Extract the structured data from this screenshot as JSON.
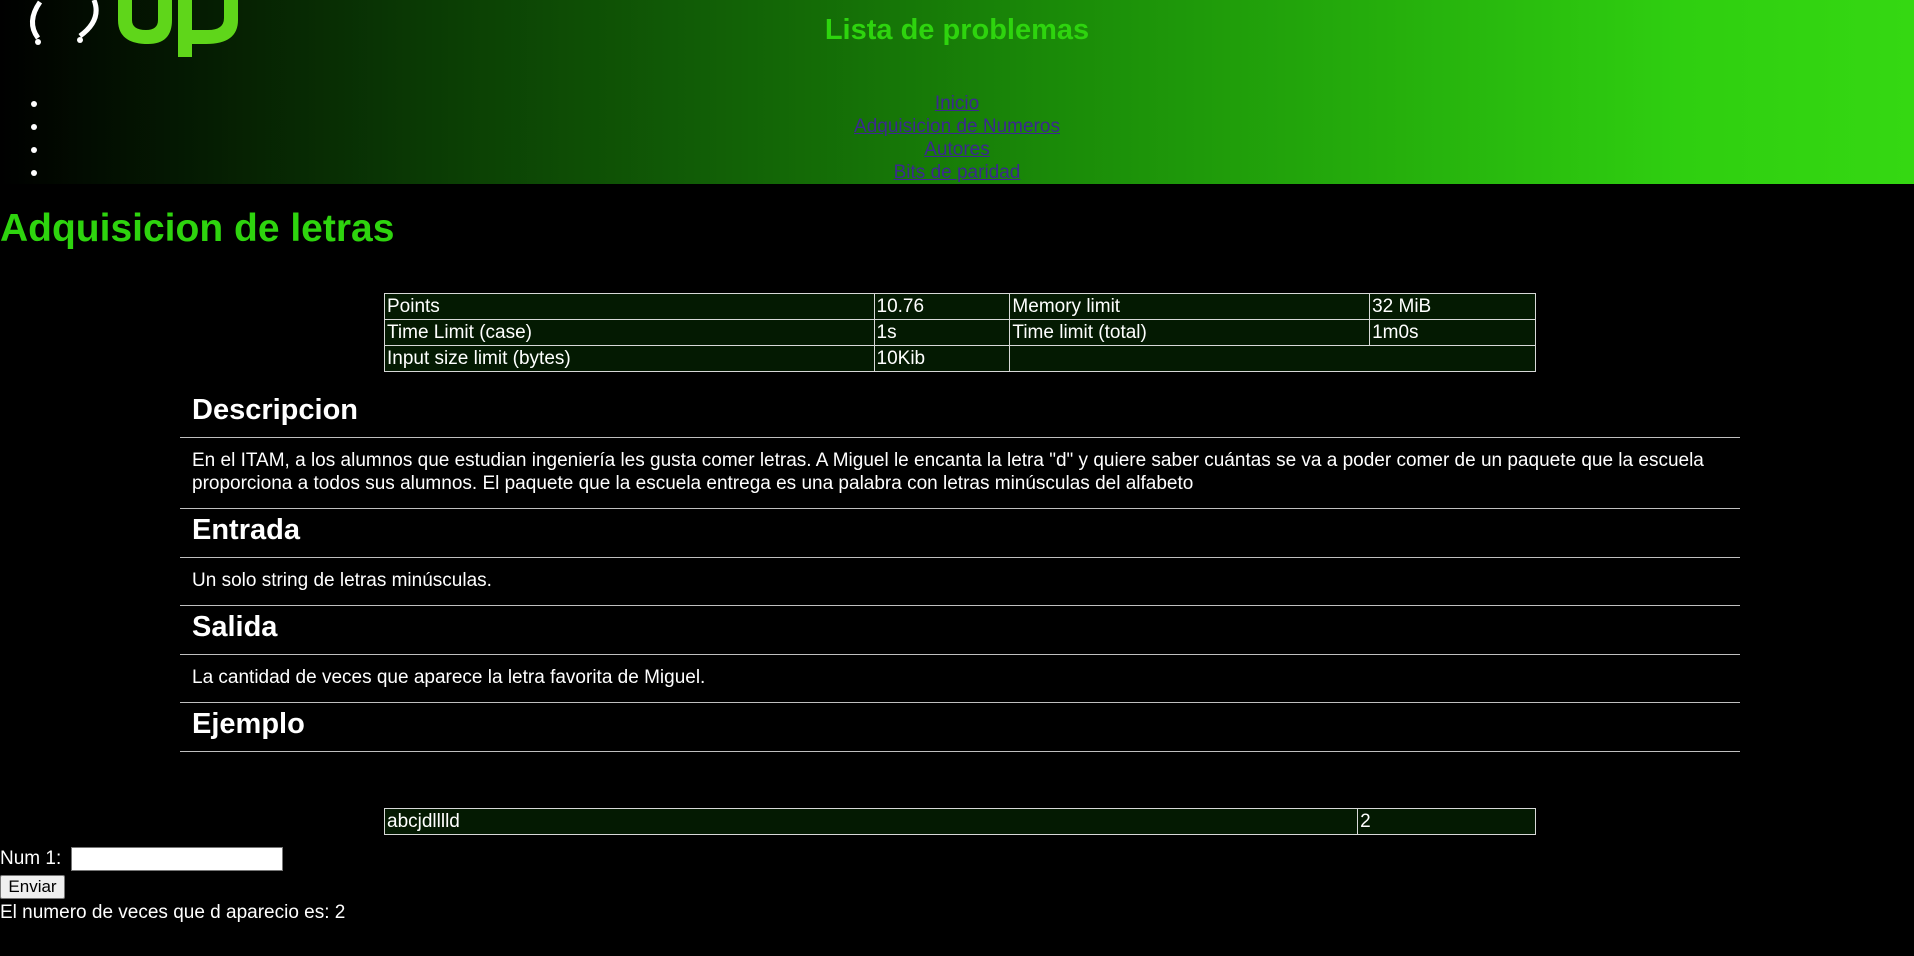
{
  "header": {
    "site_title": "Lista de problemas",
    "logo_text": "Up",
    "nav_items": [
      "Inicio",
      "Adquisicion de Numeros",
      "Autores",
      "Bits de paridad"
    ]
  },
  "problem": {
    "title": "Adquisicion de letras",
    "info": [
      [
        "Points",
        "10.76",
        "Memory limit",
        "32 MiB"
      ],
      [
        "Time Limit (case)",
        "1s",
        "Time limit (total)",
        "1m0s"
      ],
      [
        "Input size limit (bytes)",
        "10Kib",
        ""
      ]
    ],
    "sections": [
      {
        "heading": "Descripcion",
        "body": "En el ITAM, a los alumnos que estudian ingeniería les gusta comer letras. A Miguel le encanta la letra \"d\" y quiere saber cuántas se va a poder comer de un paquete que la escuela proporciona a todos sus alumnos. El paquete que la escuela entrega es una palabra con letras minúsculas del alfabeto"
      },
      {
        "heading": "Entrada",
        "body": "Un solo string de letras minúsculas."
      },
      {
        "heading": "Salida",
        "body": "La cantidad de veces que aparece la letra favorita de Miguel."
      },
      {
        "heading": "Ejemplo"
      }
    ],
    "example": {
      "input": "abcjdlllld",
      "output": "2"
    }
  },
  "form": {
    "label": "Num 1:",
    "input_value": "",
    "submit_label": "Enviar",
    "result": "El numero de veces que d aparecio es: 2"
  },
  "colors": {
    "accent": "#2ed40e",
    "link": "#3c2890",
    "table_bg": "#041a02"
  }
}
